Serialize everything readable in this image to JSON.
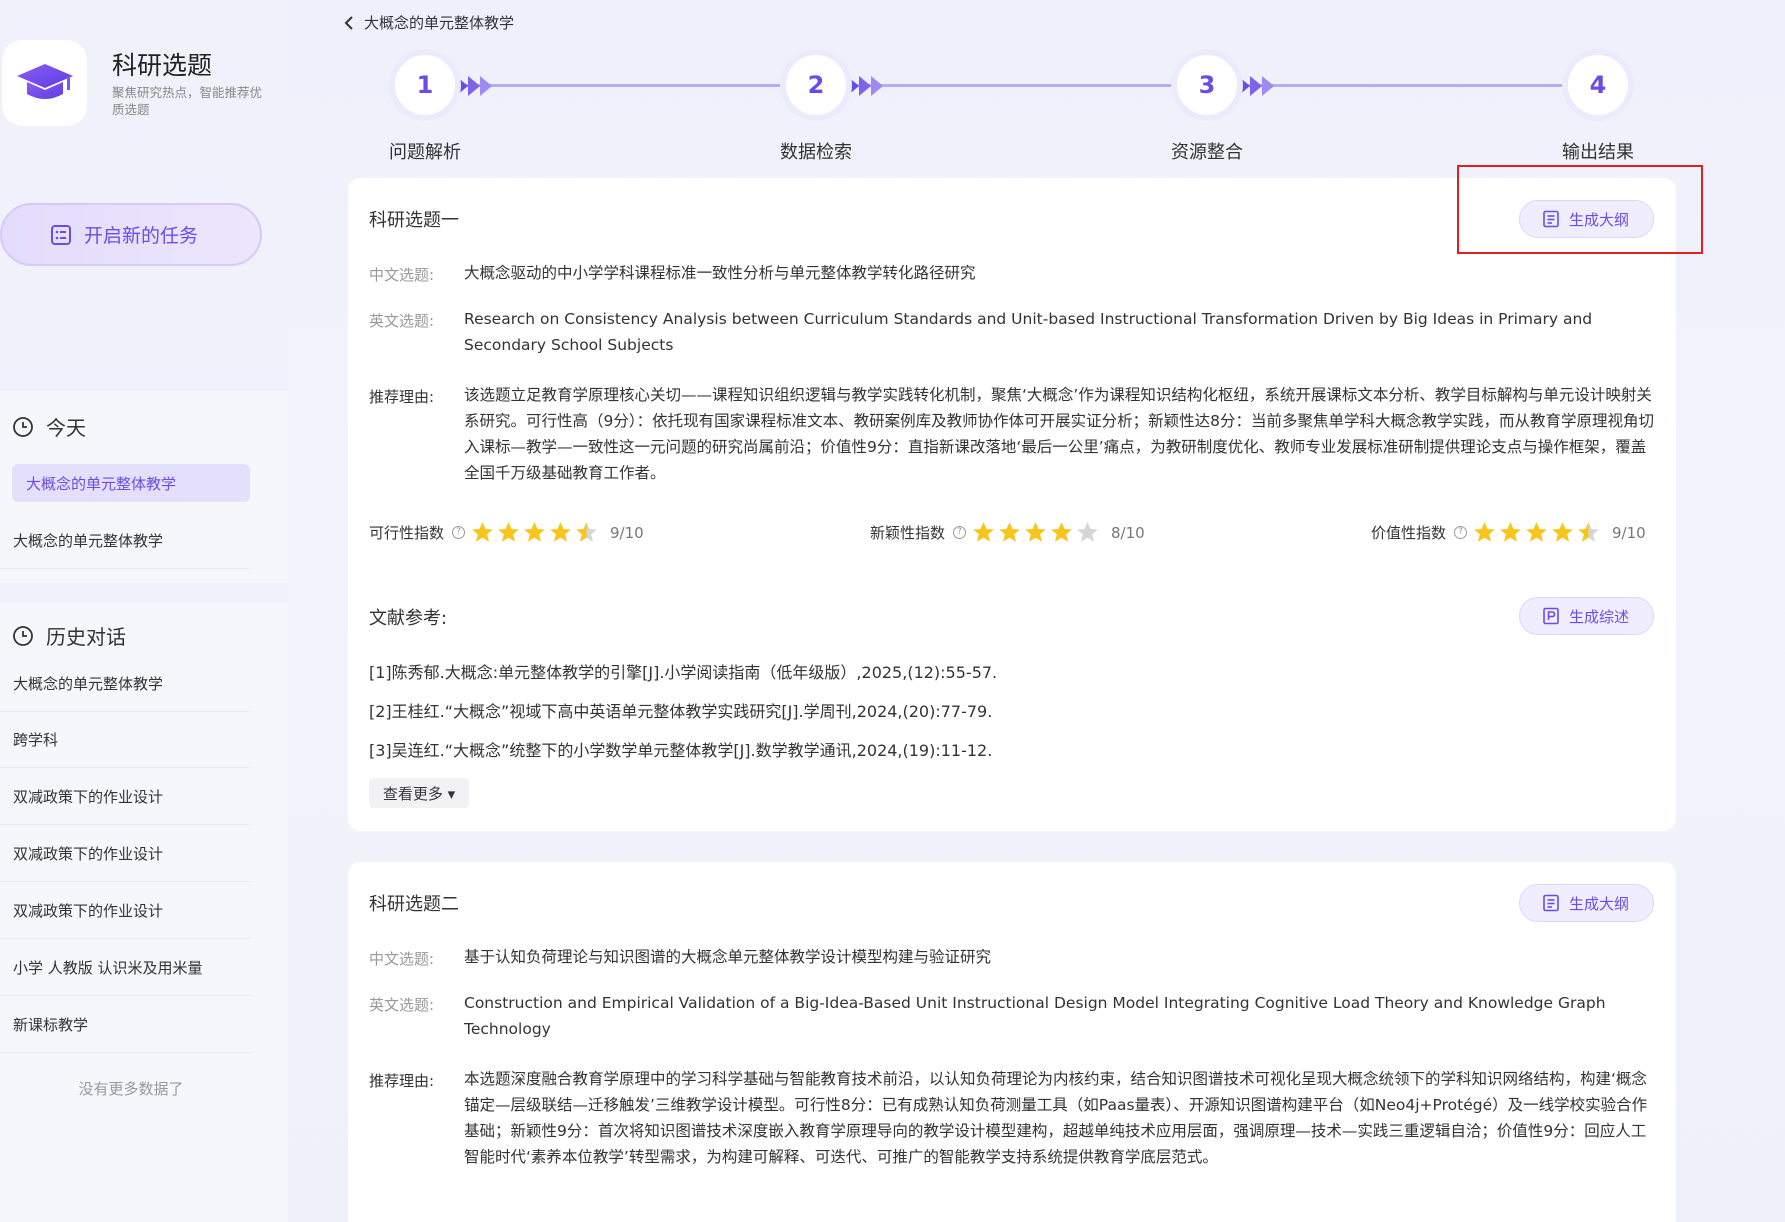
{
  "app": {
    "title": "科研选题",
    "subtitle": "聚焦研究热点，智能推荐优质选题",
    "logo_icon": "graduation-cap-icon"
  },
  "sidebar": {
    "new_task_label": "开启新的任务",
    "today": {
      "heading": "今天",
      "items": [
        {
          "label": "大概念的单元整体教学",
          "active": true
        },
        {
          "label": "大概念的单元整体教学",
          "active": false
        }
      ]
    },
    "history": {
      "heading": "历史对话",
      "items": [
        {
          "label": "大概念的单元整体教学"
        },
        {
          "label": "跨学科"
        },
        {
          "label": "双减政策下的作业设计"
        },
        {
          "label": "双减政策下的作业设计"
        },
        {
          "label": "双减政策下的作业设计"
        },
        {
          "label": "小学 人教版 认识米及用米量"
        },
        {
          "label": "新课标教学"
        }
      ],
      "no_more": "没有更多数据了"
    }
  },
  "breadcrumb": {
    "label": "大概念的单元整体教学"
  },
  "steps": [
    {
      "number": "1",
      "label": "问题解析"
    },
    {
      "number": "2",
      "label": "数据检索"
    },
    {
      "number": "3",
      "label": "资源整合"
    },
    {
      "number": "4",
      "label": "输出结果"
    }
  ],
  "topics": [
    {
      "title": "科研选题一",
      "outline_button": "生成大纲",
      "cn_label": "中文选题:",
      "cn_title": "大概念驱动的中小学学科课程标准一致性分析与单元整体教学转化路径研究",
      "en_label": "英文选题:",
      "en_title": "Research on Consistency Analysis between Curriculum Standards and Unit-based Instructional Transformation Driven by Big Ideas in Primary and Secondary School Subjects",
      "reason_label": "推荐理由:",
      "reason": "该选题立足教育学原理核心关切——课程知识组织逻辑与教学实践转化机制，聚焦‘大概念’作为课程知识结构化枢纽，系统开展课标文本分析、教学目标解构与单元设计映射关系研究。可行性高（9分）：依托现有国家课程标准文本、教研案例库及教师协作体可开展实证分析；新颖性达8分：当前多聚焦单学科大概念教学实践，而从教育学原理视角切入课标—教学—一致性这一元问题的研究尚属前沿；价值性9分：直指新课改落地‘最后一公里’痛点，为教研制度优化、教师专业发展标准研制提供理论支点与操作框架，覆盖全国千万级基础教育工作者。",
      "scores": [
        {
          "label": "可行性指数",
          "value": 9,
          "max": 10,
          "text": "9/10"
        },
        {
          "label": "新颖性指数",
          "value": 8,
          "max": 10,
          "text": "8/10"
        },
        {
          "label": "价值性指数",
          "value": 9,
          "max": 10,
          "text": "9/10"
        }
      ],
      "refs_heading": "文献参考:",
      "summary_button": "生成综述",
      "refs": [
        "[1]陈秀郁.大概念:单元整体教学的引擎[J].小学阅读指南（低年级版）,2025,(12):55-57.",
        "[2]王桂红.“大概念”视域下高中英语单元整体教学实践研究[J].学周刊,2024,(20):77-79.",
        "[3]吴连红.“大概念”统整下的小学数学单元整体教学[J].数学教学通讯,2024,(19):11-12."
      ],
      "see_more": "查看更多 ▾"
    },
    {
      "title": "科研选题二",
      "outline_button": "生成大纲",
      "cn_label": "中文选题:",
      "cn_title": "基于认知负荷理论与知识图谱的大概念单元整体教学设计模型构建与验证研究",
      "en_label": "英文选题:",
      "en_title": "Construction and Empirical Validation of a Big-Idea-Based Unit Instructional Design Model Integrating Cognitive Load Theory and Knowledge Graph Technology",
      "reason_label": "推荐理由:",
      "reason": "本选题深度融合教育学原理中的学习科学基础与智能教育技术前沿，以认知负荷理论为内核约束，结合知识图谱技术可视化呈现大概念统领下的学科知识网络结构，构建‘概念锚定—层级联结—迁移触发’三维教学设计模型。可行性8分：已有成熟认知负荷测量工具（如Paas量表）、开源知识图谱构建平台（如Neo4j+Protégé）及一线学校实验合作基础；新颖性9分：首次将知识图谱技术深度嵌入教育学原理导向的教学设计模型建构，超越单纯技术应用层面，强调原理—技术—实践三重逻辑自洽；价值性9分：回应人工智能时代‘素养本位教学’转型需求，为构建可解释、可迭代、可推广的智能教学支持系统提供教育学底层范式。"
    }
  ],
  "colors": {
    "accent": "#6a4de6",
    "star": "#f8c51c",
    "star_empty": "#d6d6d6",
    "highlight": "#e02020"
  }
}
